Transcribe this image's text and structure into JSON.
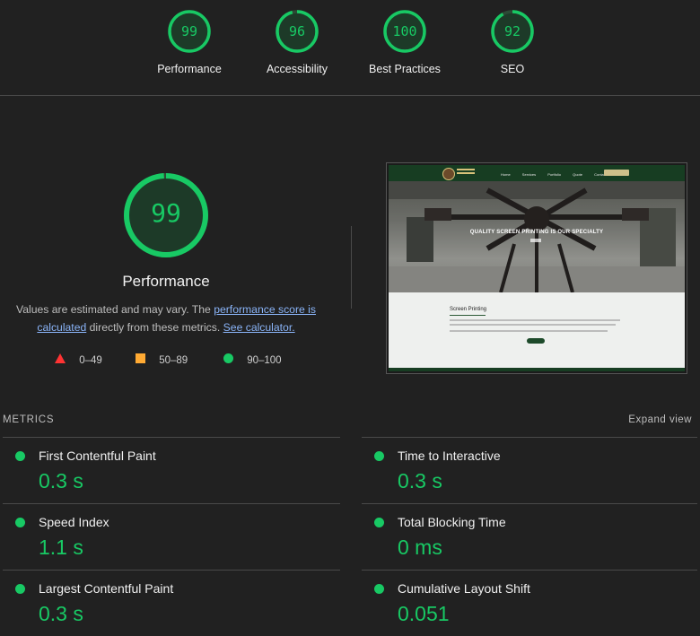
{
  "top_gauges": [
    {
      "score": "99",
      "label": "Performance"
    },
    {
      "score": "96",
      "label": "Accessibility"
    },
    {
      "score": "100",
      "label": "Best Practices"
    },
    {
      "score": "92",
      "label": "SEO"
    }
  ],
  "performance": {
    "score": "99",
    "title": "Performance",
    "desc_prefix": "Values are estimated and may vary. The ",
    "link_score": "performance score is calculated",
    "desc_middle": " directly from these metrics. ",
    "link_calc": "See calculator."
  },
  "legend": [
    {
      "icon": "triangle-red-icon",
      "range": "0–49"
    },
    {
      "icon": "square-orange-icon",
      "range": "50–89"
    },
    {
      "icon": "circle-green-icon",
      "range": "90–100"
    }
  ],
  "screenshot": {
    "hero_text": "QUALITY SCREEN PRINTING IS OUR SPECIALTY",
    "section_title": "Screen Printing",
    "nav_links": [
      "Home",
      "Services",
      "Portfolio",
      "Quote",
      "Contact",
      "About"
    ]
  },
  "metrics": {
    "heading": "METRICS",
    "expand": "Expand view",
    "items": [
      {
        "label": "First Contentful Paint",
        "value": "0.3 s"
      },
      {
        "label": "Time to Interactive",
        "value": "0.3 s"
      },
      {
        "label": "Speed Index",
        "value": "1.1 s"
      },
      {
        "label": "Total Blocking Time",
        "value": "0 ms"
      },
      {
        "label": "Largest Contentful Paint",
        "value": "0.3 s"
      },
      {
        "label": "Cumulative Layout Shift",
        "value": "0.051"
      }
    ]
  },
  "colors": {
    "pass": "#18c964",
    "fail": "#ff3333",
    "average": "#ffaa33",
    "background": "#212121"
  }
}
